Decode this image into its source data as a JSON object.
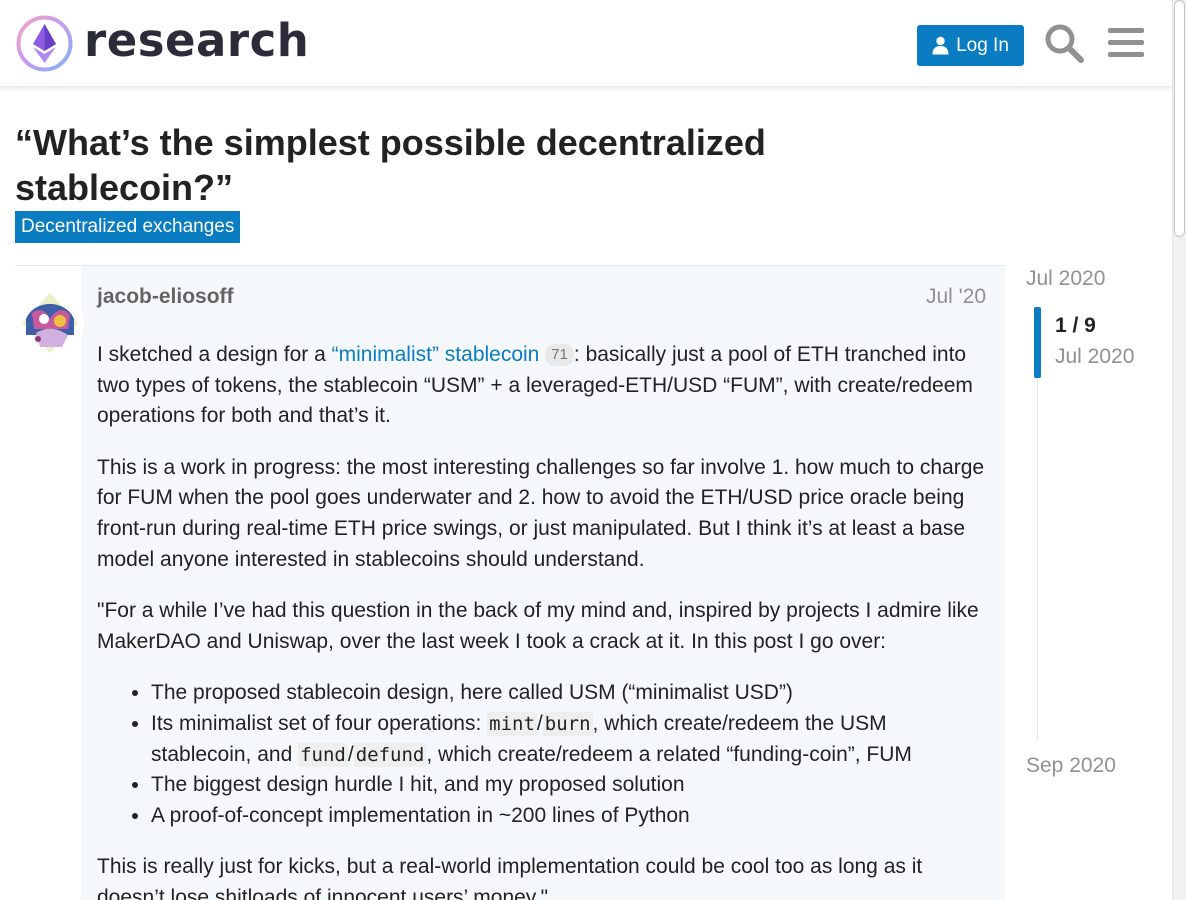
{
  "header": {
    "logo_text": "research",
    "login_label": "Log In",
    "search_icon": "search-icon",
    "menu_icon": "hamburger-menu-icon",
    "accent_color": "#0a7cc1"
  },
  "topic": {
    "title": "“What’s the simplest possible decentralized stablecoin?”",
    "category": "Decentralized exchanges"
  },
  "post": {
    "username": "jacob-eliosoff",
    "date": "Jul '20",
    "p1_before": "I sketched a design for a ",
    "p1_link": "“minimalist” stablecoin",
    "p1_clicks": "71",
    "p1_after": ": basically just a pool of ETH tranched into two types of tokens, the stablecoin “USM” + a leveraged-ETH/USD “FUM”, with create/redeem operations for both and that’s it.",
    "p2": "This is a work in progress: the most interesting challenges so far involve 1. how much to charge for FUM when the pool goes underwater and 2. how to avoid the ETH/USD price oracle being front-run during real-time ETH price swings, or just manipulated. But I think it’s at least a base model anyone interested in stablecoins should understand.",
    "p3": "\"For a while I’ve had this question in the back of my mind and, inspired by projects I admire like MakerDAO and Uniswap, over the last week I took a crack at it. In this post I go over:",
    "li1": "The proposed stablecoin design, here called USM (“minimalist USD”)",
    "li2_a": "Its minimalist set of four operations: ",
    "li2_code1": "mint",
    "li2_slash1": "/",
    "li2_code2": "burn",
    "li2_b": ", which create/redeem the USM stablecoin, and ",
    "li2_code3": "fund",
    "li2_slash2": "/",
    "li2_code4": "defund",
    "li2_c": ", which create/redeem a related “funding-coin”, FUM",
    "li3": "The biggest design hurdle I hit, and my proposed solution",
    "li4": "A proof-of-concept implementation in ~200 lines of Python",
    "p4": "This is really just for kicks, but a real-world implementation could be cool too as long as it doesn’t lose shitloads of innocent users’ money.\""
  },
  "timeline": {
    "start": "Jul 2020",
    "position": "1 / 9",
    "position_date": "Jul 2020",
    "end": "Sep 2020"
  }
}
